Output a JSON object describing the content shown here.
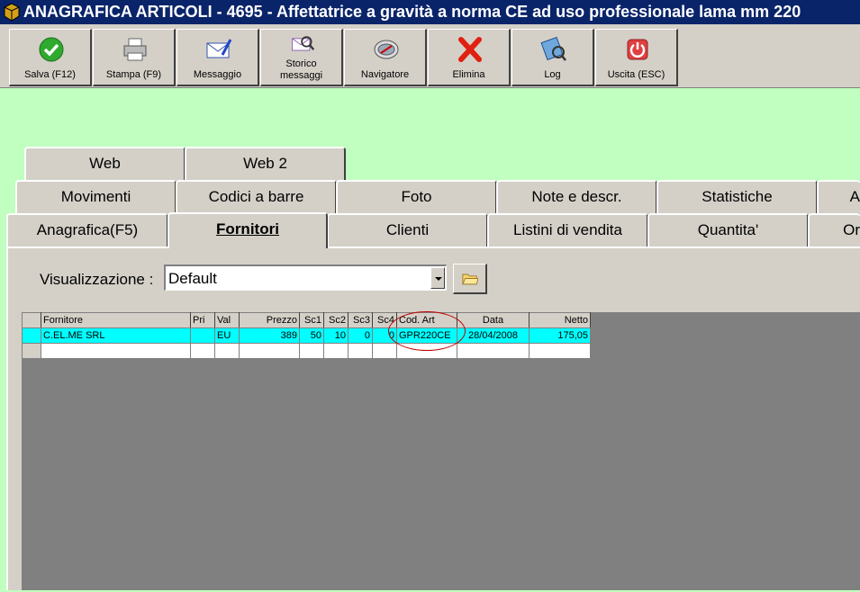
{
  "window": {
    "title": "ANAGRAFICA ARTICOLI - 4695 - Affettatrice a gravità a norma CE ad uso professionale lama mm 220"
  },
  "toolbar": {
    "buttons": [
      {
        "label": "Salva (F12)",
        "icon": "check-icon"
      },
      {
        "label": "Stampa (F9)",
        "icon": "printer-icon"
      },
      {
        "label": "Messaggio",
        "icon": "envelope-pen-icon"
      },
      {
        "label": "Storico\nmessaggi",
        "icon": "message-history-icon"
      },
      {
        "label": "Navigatore",
        "icon": "compass-icon"
      },
      {
        "label": "Elimina",
        "icon": "delete-x-icon"
      },
      {
        "label": "Log",
        "icon": "log-icon"
      },
      {
        "label": "Uscita (ESC)",
        "icon": "exit-icon"
      }
    ]
  },
  "tabs": {
    "row1": [
      "Web",
      "Web 2"
    ],
    "row2": [
      "Movimenti",
      "Codici a barre",
      "Foto",
      "Note e descr.",
      "Statistiche",
      "A"
    ],
    "row3": [
      "Anagrafica(F5)",
      "Fornitori",
      "Clienti",
      "Listini di vendita",
      "Quantita'",
      "Or"
    ],
    "active": "Fornitori"
  },
  "view": {
    "label": "Visualizzazione :",
    "selected": "Default"
  },
  "grid": {
    "columns": [
      "Fornitore",
      "Pri",
      "Val",
      "Prezzo",
      "Sc1",
      "Sc2",
      "Sc3",
      "Sc4",
      "Cod. Art",
      "Data",
      "Netto"
    ],
    "rows": [
      {
        "fornitore": "C.EL.ME SRL",
        "pri": "",
        "val": "EU",
        "prezzo": "389",
        "sc1": "50",
        "sc2": "10",
        "sc3": "0",
        "sc4": "0",
        "cod_art": "GPR220CE",
        "data": "28/04/2008",
        "netto": "175,05"
      }
    ]
  },
  "colors": {
    "titlebar": "#0a246a",
    "background": "#c0ffc0",
    "selected_row": "#00ffff",
    "annotation_circle": "#c00000"
  }
}
